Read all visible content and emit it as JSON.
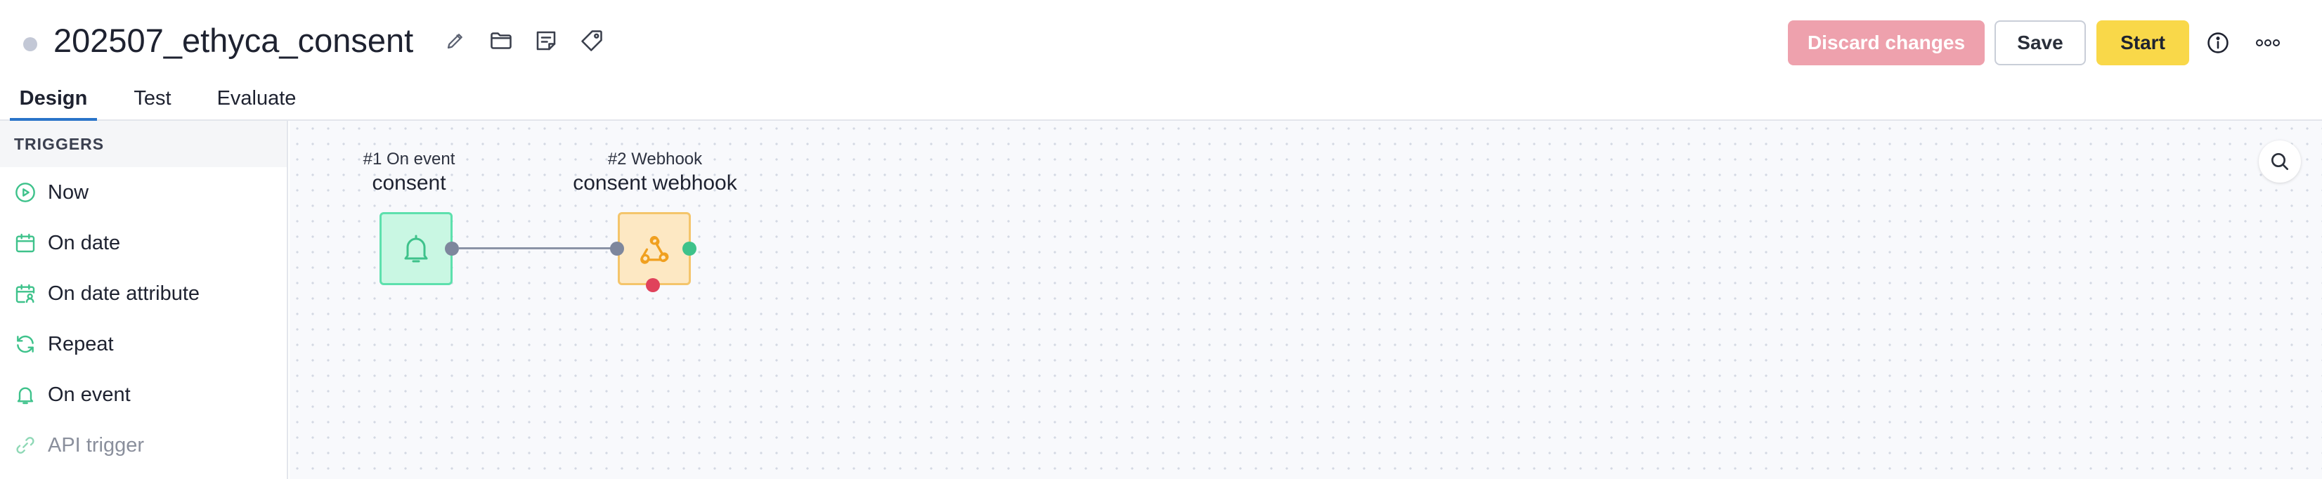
{
  "header": {
    "title": "202507_ethyca_consent",
    "status_color": "#c3c8d6",
    "title_icons": [
      "pencil-icon",
      "folder-icon",
      "note-icon",
      "tag-icon"
    ],
    "buttons": {
      "discard": "Discard changes",
      "save": "Save",
      "start": "Start"
    },
    "right_icons": [
      "info-icon",
      "more-icon"
    ]
  },
  "tabs": [
    {
      "label": "Design",
      "active": true
    },
    {
      "label": "Test",
      "active": false
    },
    {
      "label": "Evaluate",
      "active": false
    }
  ],
  "sidebar": {
    "header": "TRIGGERS",
    "items": [
      {
        "label": "Now",
        "icon": "play-circle-icon"
      },
      {
        "label": "On date",
        "icon": "calendar-icon"
      },
      {
        "label": "On date attribute",
        "icon": "calendar-user-icon"
      },
      {
        "label": "Repeat",
        "icon": "repeat-icon"
      },
      {
        "label": "On event",
        "icon": "bell-icon"
      },
      {
        "label": "API trigger",
        "icon": "link-icon",
        "muted": true
      }
    ]
  },
  "canvas": {
    "nodes": [
      {
        "step": "#1 On event",
        "name": "consent",
        "icon": "bell-icon",
        "color": "#c9f7e3"
      },
      {
        "step": "#2 Webhook",
        "name": "consent webhook",
        "icon": "webhook-icon",
        "color": "#fde8c3"
      }
    ],
    "zoom_icon": "search-icon"
  },
  "colors": {
    "accent_tab": "#2a74c9",
    "discard_button": "#eea1ad",
    "start_button": "#f9d849",
    "trigger_icon": "#3ec28b"
  }
}
